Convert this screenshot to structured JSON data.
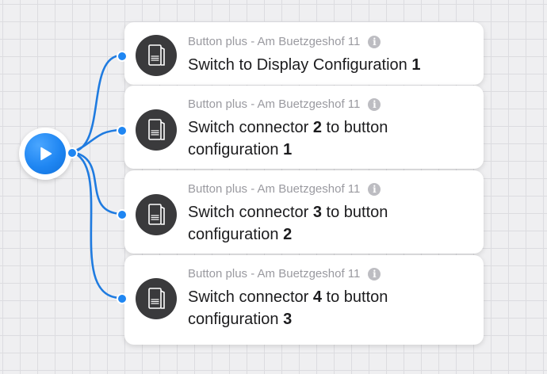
{
  "colors": {
    "accent": "#1f86f2",
    "wire": "#1f7be0",
    "icon_bg": "#3a3a3c"
  },
  "trigger": {
    "icon": "play-icon"
  },
  "cards": [
    {
      "subtitle": "Button plus - Am Buetzgeshof 11",
      "title_parts": [
        {
          "text": "Switch to Display Configuration ",
          "bold": false
        },
        {
          "text": "1",
          "bold": true
        }
      ],
      "icon": "device-icon",
      "info_icon": "info-icon"
    },
    {
      "subtitle": "Button plus - Am Buetzgeshof 11",
      "title_parts": [
        {
          "text": "Switch connector ",
          "bold": false
        },
        {
          "text": "2",
          "bold": true
        },
        {
          "text": " to button configuration ",
          "bold": false
        },
        {
          "text": "1",
          "bold": true
        }
      ],
      "icon": "device-icon",
      "info_icon": "info-icon"
    },
    {
      "subtitle": "Button plus - Am Buetzgeshof 11",
      "title_parts": [
        {
          "text": "Switch connector ",
          "bold": false
        },
        {
          "text": "3",
          "bold": true
        },
        {
          "text": " to button configuration ",
          "bold": false
        },
        {
          "text": "2",
          "bold": true
        }
      ],
      "icon": "device-icon",
      "info_icon": "info-icon"
    },
    {
      "subtitle": "Button plus - Am Buetzgeshof 11",
      "title_parts": [
        {
          "text": "Switch connector ",
          "bold": false
        },
        {
          "text": "4",
          "bold": true
        },
        {
          "text": " to button configuration ",
          "bold": false
        },
        {
          "text": "3",
          "bold": true
        }
      ],
      "icon": "device-icon",
      "info_icon": "info-icon"
    }
  ]
}
